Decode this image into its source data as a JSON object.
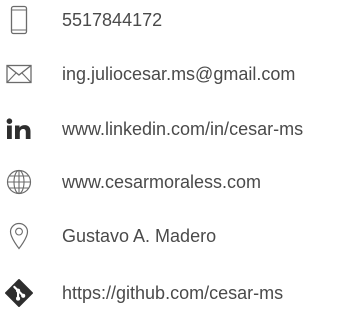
{
  "contacts": [
    {
      "type": "phone",
      "icon": "phone-icon",
      "value": "5517844172"
    },
    {
      "type": "email",
      "icon": "mail-icon",
      "value": "ing.juliocesar.ms@gmail.com"
    },
    {
      "type": "linkedin",
      "icon": "linkedin-icon",
      "value": "www.linkedin.com/in/cesar-ms"
    },
    {
      "type": "website",
      "icon": "globe-icon",
      "value": "www.cesarmoraless.com"
    },
    {
      "type": "address",
      "icon": "location-pin-icon",
      "value": "Gustavo A. Madero"
    },
    {
      "type": "github",
      "icon": "git-icon",
      "value": "https://github.com/cesar-ms"
    }
  ],
  "colors": {
    "icon": "#6b6b6b",
    "text": "#4a4a4a",
    "background": "#ffffff"
  }
}
